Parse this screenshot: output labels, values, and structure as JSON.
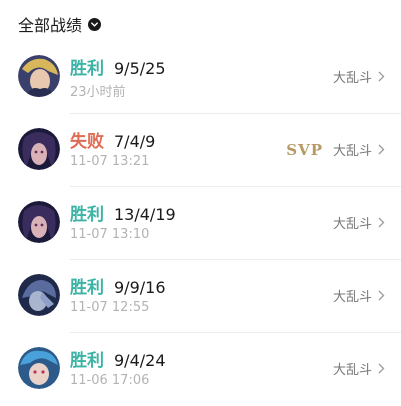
{
  "header": {
    "title": "全部战绩",
    "chevron_icon": "chevron-down-circle-icon"
  },
  "matches": [
    {
      "result": "胜利",
      "outcome": "win",
      "kda": "9/5/25",
      "time": "23小时前",
      "mode": "大乱斗",
      "badge": "",
      "avatar": "champion-avatar-1"
    },
    {
      "result": "失败",
      "outcome": "lose",
      "kda": "7/4/9",
      "time": "11-07 13:21",
      "mode": "大乱斗",
      "badge": "SVP",
      "avatar": "champion-avatar-2"
    },
    {
      "result": "胜利",
      "outcome": "win",
      "kda": "13/4/19",
      "time": "11-07 13:10",
      "mode": "大乱斗",
      "badge": "",
      "avatar": "champion-avatar-3"
    },
    {
      "result": "胜利",
      "outcome": "win",
      "kda": "9/9/16",
      "time": "11-07 12:55",
      "mode": "大乱斗",
      "badge": "",
      "avatar": "champion-avatar-4"
    },
    {
      "result": "胜利",
      "outcome": "win",
      "kda": "9/4/24",
      "time": "11-06 17:06",
      "mode": "大乱斗",
      "badge": "",
      "avatar": "champion-avatar-5"
    }
  ],
  "colors": {
    "win": "#3bb3a5",
    "lose": "#e06b54",
    "svp": "#b59a63",
    "muted": "#b3b3b3"
  }
}
